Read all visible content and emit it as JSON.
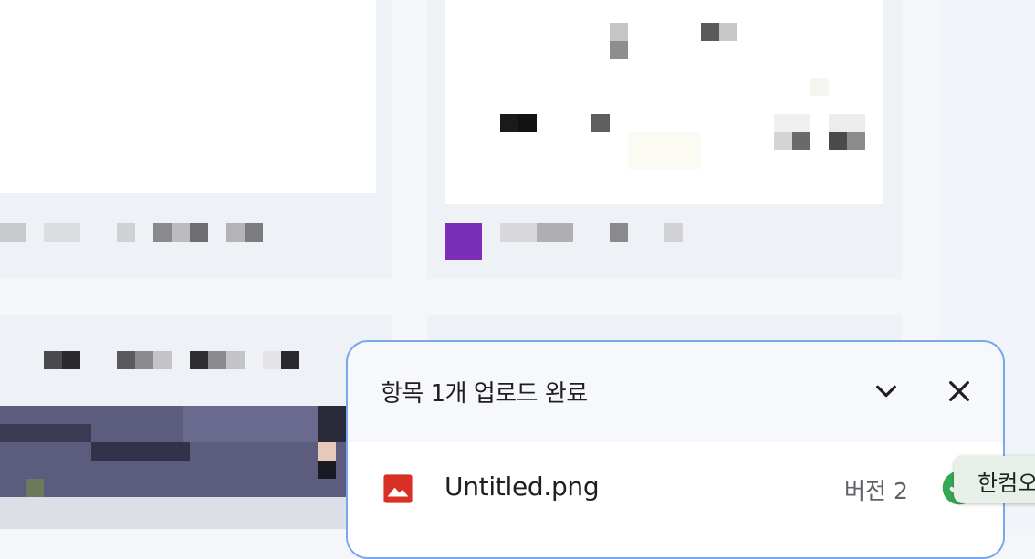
{
  "upload_panel": {
    "title": "항목 1개 업로드 완료",
    "collapse_icon": "chevron-down-icon",
    "close_icon": "close-icon",
    "file": {
      "name": "Untitled.png",
      "version": "버전 2",
      "type_icon": "image-file-icon",
      "status_icon": "check-circle-icon"
    }
  },
  "tooltip": {
    "text": "한컴오"
  },
  "colors": {
    "panel_border": "#79a6f0",
    "image_icon_red": "#d93025",
    "check_green": "#34a853",
    "pixel_purple": "#7b2fb8"
  }
}
